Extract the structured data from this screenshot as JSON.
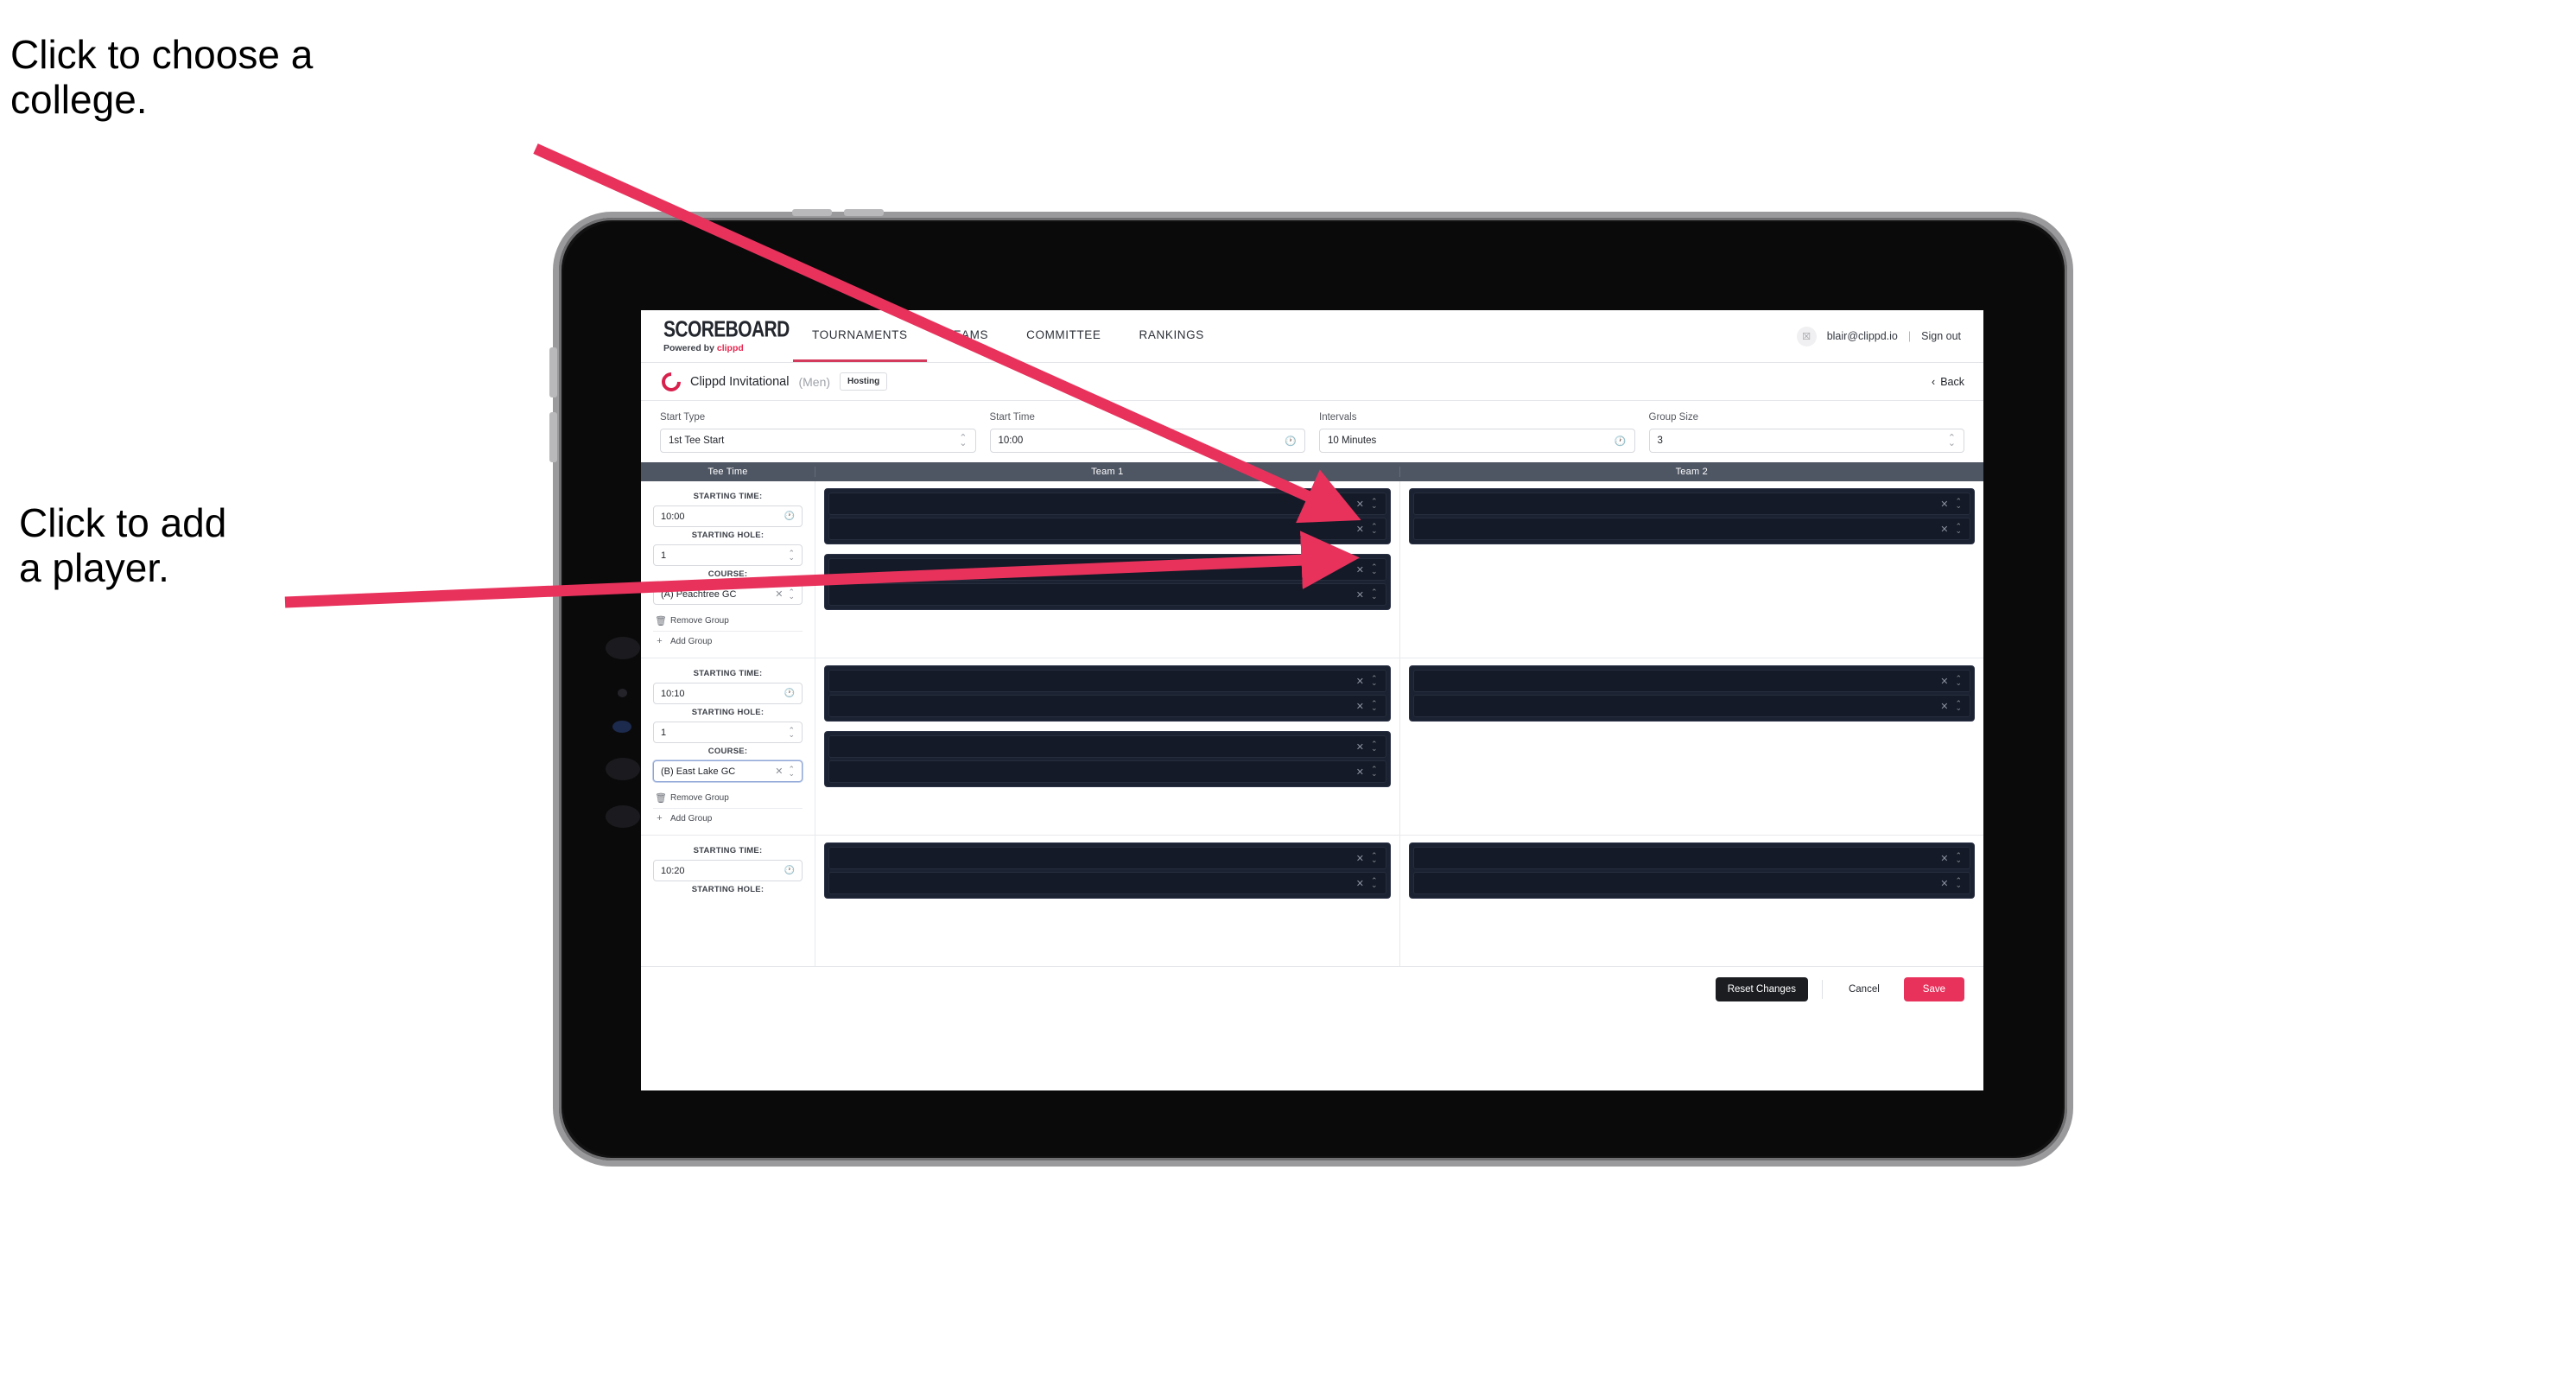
{
  "annotations": [
    {
      "id": "annot-college",
      "text": "Click to choose a\ncollege."
    },
    {
      "id": "annot-player",
      "text": "Click to add\na player."
    }
  ],
  "accent": {
    "pink": "#e8325c",
    "arrow": "#e8325c",
    "headerbar": "#4e5563",
    "dark": "#1b2231"
  },
  "app": {
    "topnav": {
      "brand_title": "SCOREBOARD",
      "brand_sub_prefix": "Powered by ",
      "brand_sub_highlight": "clippd",
      "items": [
        {
          "label": "TOURNAMENTS",
          "active": true
        },
        {
          "label": "TEAMS",
          "active": false
        },
        {
          "label": "COMMITTEE",
          "active": false
        },
        {
          "label": "RANKINGS",
          "active": false
        }
      ],
      "user_email": "blair@clippd.io",
      "separator": "|",
      "sign_out": "Sign out",
      "avatar_glyph": "☒"
    },
    "subheader": {
      "tournament_name": "Clippd Invitational",
      "gender": "(Men)",
      "badge": "Hosting",
      "back_label": "Back",
      "back_chevron": "‹"
    },
    "controls": [
      {
        "label": "Start Type",
        "value": "1st Tee Start",
        "icon": "stepper"
      },
      {
        "label": "Start Time",
        "value": "10:00",
        "icon": "clock"
      },
      {
        "label": "Intervals",
        "value": "10 Minutes",
        "icon": "clock"
      },
      {
        "label": "Group Size",
        "value": "3",
        "icon": "stepper"
      }
    ],
    "table": {
      "headers": {
        "tee_time": "Tee Time",
        "team1": "Team 1",
        "team2": "Team 2"
      },
      "labels": {
        "starting_time": "STARTING TIME:",
        "starting_hole": "STARTING HOLE:",
        "course": "COURSE:",
        "remove_group": "Remove Group",
        "add_group": "Add Group"
      },
      "rows": [
        {
          "starting_time": "10:00",
          "starting_hole": "1",
          "course": "(A) Peachtree GC",
          "course_focused": false,
          "team1_groups": [
            {
              "players": [
                "",
                ""
              ]
            },
            {
              "players": [
                "",
                ""
              ]
            }
          ],
          "team2_groups": [
            {
              "players": [
                "",
                ""
              ]
            }
          ]
        },
        {
          "starting_time": "10:10",
          "starting_hole": "1",
          "course": "(B) East Lake GC",
          "course_focused": true,
          "team1_groups": [
            {
              "players": [
                "",
                ""
              ]
            },
            {
              "players": [
                "",
                ""
              ]
            }
          ],
          "team2_groups": [
            {
              "players": [
                "",
                ""
              ]
            }
          ]
        },
        {
          "starting_time": "10:20",
          "starting_hole": "",
          "course": "",
          "course_focused": false,
          "team1_groups": [
            {
              "players": [
                "",
                ""
              ]
            }
          ],
          "team2_groups": [
            {
              "players": [
                "",
                ""
              ]
            }
          ]
        }
      ]
    },
    "footer": {
      "reset_label": "Reset Changes",
      "cancel_label": "Cancel",
      "save_label": "Save"
    }
  }
}
